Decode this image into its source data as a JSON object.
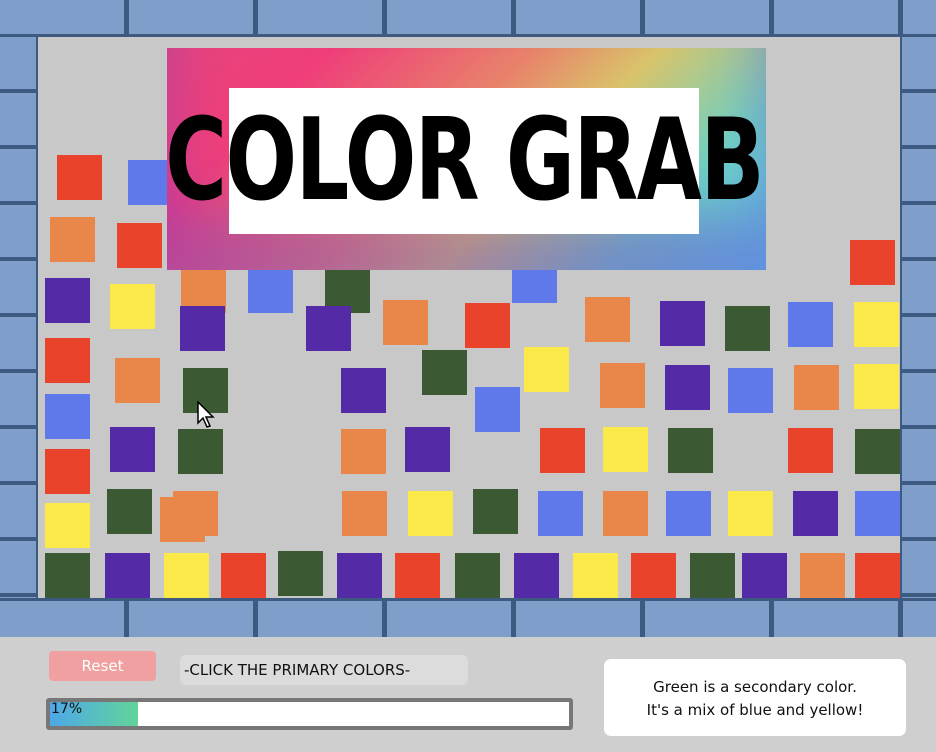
{
  "game": {
    "title": "COLOR GRAB",
    "colors": {
      "red": "#e9442b",
      "orange": "#e9874a",
      "yellow": "#fbe94a",
      "green": "#3b5a33",
      "blue": "#6079ea",
      "purple": "#542aa6"
    },
    "tiles": [
      {
        "c": "red"
      },
      {
        "c": "blue"
      },
      {
        "c": "orange"
      },
      {
        "c": "red"
      },
      {
        "c": "purple"
      },
      {
        "c": "yellow"
      },
      {
        "c": "orange"
      },
      {
        "c": "blue"
      },
      {
        "c": "green"
      },
      {
        "c": "blue"
      },
      {
        "c": "red"
      },
      {
        "c": "purple"
      },
      {
        "c": "purple"
      },
      {
        "c": "orange"
      },
      {
        "c": "red"
      },
      {
        "c": "orange"
      },
      {
        "c": "purple"
      },
      {
        "c": "green"
      },
      {
        "c": "blue"
      },
      {
        "c": "yellow"
      },
      {
        "c": "red"
      },
      {
        "c": "orange"
      },
      {
        "c": "green"
      },
      {
        "c": "green"
      },
      {
        "c": "yellow"
      },
      {
        "c": "purple"
      },
      {
        "c": "orange"
      },
      {
        "c": "purple"
      },
      {
        "c": "blue"
      },
      {
        "c": "orange"
      },
      {
        "c": "yellow"
      },
      {
        "c": "blue"
      },
      {
        "c": "blue"
      },
      {
        "c": "purple"
      },
      {
        "c": "green"
      },
      {
        "c": "orange"
      },
      {
        "c": "purple"
      },
      {
        "c": "red"
      },
      {
        "c": "yellow"
      },
      {
        "c": "green"
      },
      {
        "c": "red"
      },
      {
        "c": "green"
      },
      {
        "c": "red"
      },
      {
        "c": "yellow"
      },
      {
        "c": "green"
      },
      {
        "c": "orange"
      },
      {
        "c": "orange"
      },
      {
        "c": "yellow"
      },
      {
        "c": "green"
      },
      {
        "c": "blue"
      },
      {
        "c": "orange"
      },
      {
        "c": "blue"
      },
      {
        "c": "yellow"
      },
      {
        "c": "purple"
      },
      {
        "c": "blue"
      },
      {
        "c": "green"
      },
      {
        "c": "purple"
      },
      {
        "c": "yellow"
      },
      {
        "c": "red"
      },
      {
        "c": "green"
      },
      {
        "c": "purple"
      },
      {
        "c": "red"
      },
      {
        "c": "green"
      },
      {
        "c": "purple"
      },
      {
        "c": "yellow"
      },
      {
        "c": "red"
      },
      {
        "c": "green"
      },
      {
        "c": "purple"
      },
      {
        "c": "orange"
      },
      {
        "c": "red"
      },
      {
        "c": "orange"
      },
      {
        "c": "blue"
      },
      {
        "c": "green"
      },
      {
        "c": "blue"
      }
    ]
  },
  "controls": {
    "reset_label": "Reset",
    "instruction": "-CLICK THE PRIMARY COLORS-",
    "progress": {
      "value": 0.17,
      "label": "17%"
    }
  },
  "info": {
    "line1": "Green is a secondary color.",
    "line2": "It's a mix of blue and yellow!"
  }
}
